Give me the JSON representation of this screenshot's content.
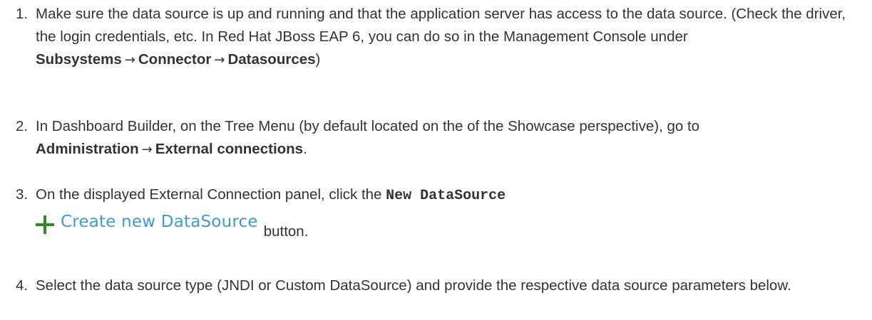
{
  "steps": [
    {
      "number": "1.",
      "text_a": "Make sure the data source is up and running and that the application server has access to the data source. (Check the driver, the login credentials, etc. In Red Hat JBoss EAP 6, you can do so in the Management Console under ",
      "bold_1": "Subsystems",
      "arrow_1": "→",
      "bold_2": "Connector",
      "arrow_2": "→",
      "bold_3": "Datasources",
      "text_b": ")"
    },
    {
      "number": "2.",
      "text_a": "In Dashboard Builder, on the Tree Menu (by default located on the of the Showcase perspective), go to ",
      "bold_1": "Administration",
      "arrow_1": "→",
      "bold_2": "External connections",
      "text_b": "."
    },
    {
      "number": "3.",
      "text_a": "On the displayed External Connection panel, click the ",
      "code_1": "New DataSource",
      "button_label": "Create new DataSource",
      "text_b": "button."
    },
    {
      "number": "4.",
      "text_a": "Select the data source type (JNDI or Custom DataSource) and provide the respective data source parameters below."
    }
  ],
  "icons": {
    "plus": "plus-icon"
  },
  "colors": {
    "plus_icon": "#2f8a21",
    "create_label": "#3b9bd9",
    "text": "#333333"
  }
}
